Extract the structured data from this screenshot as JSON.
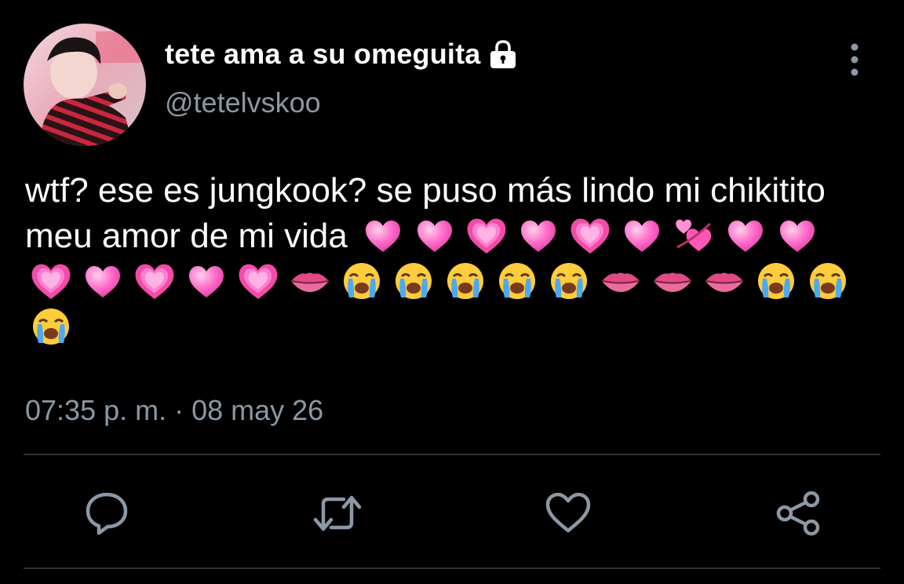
{
  "tweet": {
    "author": {
      "display_name": "tete ama a su omeguita",
      "handle": "@tetelvskoo",
      "protected_icon": "lock-icon"
    },
    "text": "wtf? ese es jungkook? se puso más lindo mi chikitito meu amor de mi vida",
    "emojis": [
      "pink-heart",
      "pink-heart",
      "growing-heart",
      "pink-heart",
      "growing-heart",
      "pink-heart",
      "revolving-hearts",
      "pink-heart",
      "pink-heart",
      "growing-heart",
      "pink-heart",
      "growing-heart",
      "pink-heart",
      "growing-heart",
      "lips",
      "crying-face",
      "crying-face",
      "crying-face",
      "crying-face",
      "crying-face",
      "lips",
      "lips",
      "lips",
      "crying-face",
      "crying-face",
      "crying-face"
    ],
    "timestamp": "07:35 p. m. · 08 may 26"
  },
  "actions": [
    {
      "name": "reply",
      "icon": "reply-icon"
    },
    {
      "name": "retweet",
      "icon": "retweet-icon"
    },
    {
      "name": "like",
      "icon": "heart-icon"
    },
    {
      "name": "share",
      "icon": "share-icon"
    }
  ],
  "colors": {
    "background": "#000000",
    "primary_text": "#ffffff",
    "secondary_text": "#8b98a5",
    "divider": "#2f3336",
    "icon": "#8b98a5"
  }
}
